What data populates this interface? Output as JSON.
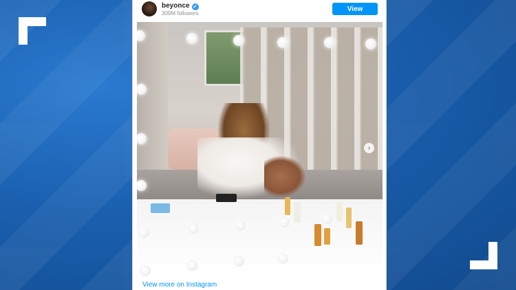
{
  "instagram_embed": {
    "username": "beyonce",
    "followers": "309M followers",
    "view_profile_label": "View profile",
    "view_more_label": "View more on Instagram",
    "verified_icon": "verified-badge-icon",
    "next_icon": "chevron-right-icon",
    "colors": {
      "button": "#0095f6",
      "background": "#1a5fae",
      "link": "#0095f6"
    }
  }
}
